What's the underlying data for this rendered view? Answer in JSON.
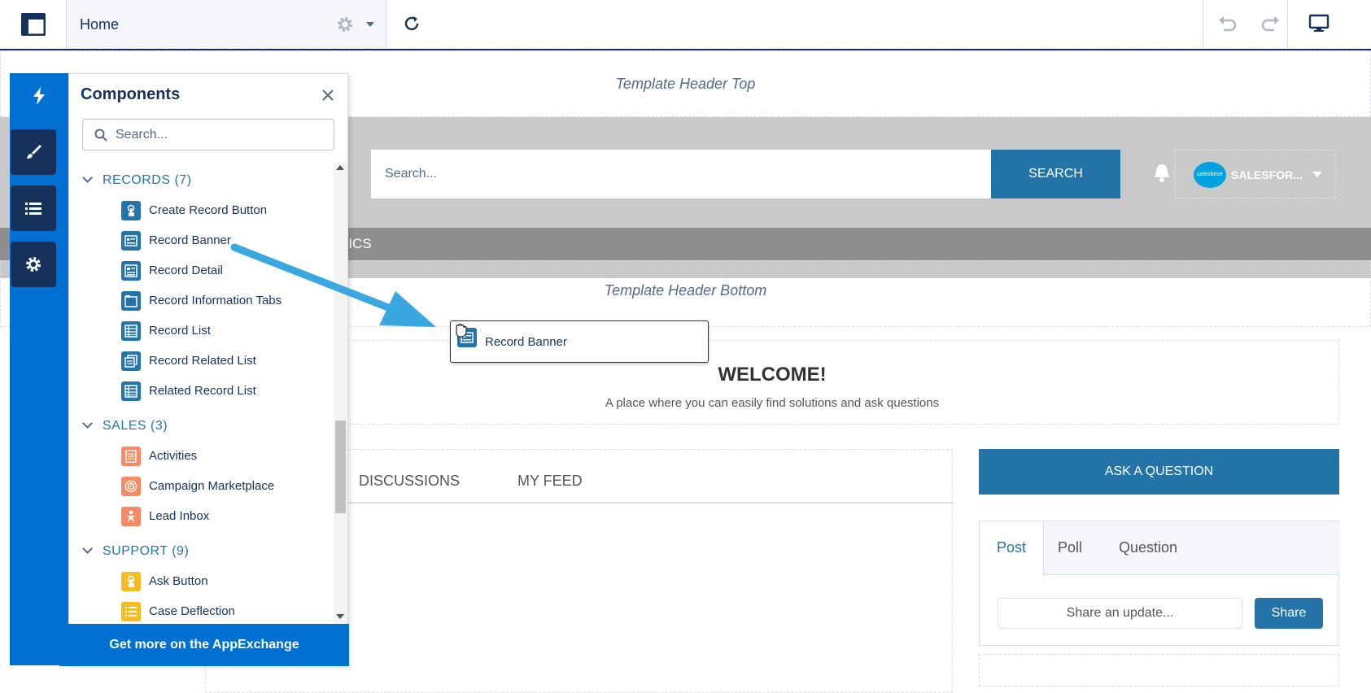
{
  "toolbar": {
    "page_title": "Home"
  },
  "canvas": {
    "template_header_top": "Template Header Top",
    "search_placeholder": "Search...",
    "search_button": "SEARCH",
    "user_logo_text": "salesforce",
    "user_name": "SALESFOR...",
    "nav_partial_text": "PICS",
    "template_header_bottom": "Template Header Bottom",
    "welcome_title": "WELCOME!",
    "welcome_subtitle": "A place where you can easily find solutions and ask questions",
    "feed_tabs": [
      "DISCUSSIONS",
      "MY FEED"
    ],
    "ask_button": "ASK A QUESTION",
    "publisher_tabs": [
      "Post",
      "Poll",
      "Question"
    ],
    "share_placeholder": "Share an update...",
    "share_button": "Share"
  },
  "panel": {
    "title": "Components",
    "search_placeholder": "Search...",
    "sections": [
      {
        "label": "RECORDS (7)",
        "color": "#2574a9",
        "items": [
          "Create Record Button",
          "Record Banner",
          "Record Detail",
          "Record Information Tabs",
          "Record List",
          "Record Related List",
          "Related Record List"
        ],
        "icons": [
          "touch-icon",
          "banner-icon",
          "detail-icon",
          "tabs-icon",
          "list-icon",
          "related-list-icon",
          "related-record-list-icon"
        ]
      },
      {
        "label": "SALES (3)",
        "color": "#f88962",
        "items": [
          "Activities",
          "Campaign Marketplace",
          "Lead Inbox"
        ],
        "icons": [
          "activities-icon",
          "target-icon",
          "lead-icon"
        ]
      },
      {
        "label": "SUPPORT (9)",
        "color": "#f4bc25",
        "items": [
          "Ask Button",
          "Case Deflection"
        ],
        "icons": [
          "touch-icon",
          "list-icon"
        ]
      }
    ],
    "footer_button": "Get more on the AppExchange"
  },
  "drag": {
    "label": "Record Banner"
  },
  "colors": {
    "brand_blue": "#0070d2",
    "navy": "#16325c",
    "button_blue": "#2574a9",
    "sales_orange": "#f88962",
    "support_yellow": "#f4bc25",
    "arrow_blue": "#3aa8e0"
  }
}
